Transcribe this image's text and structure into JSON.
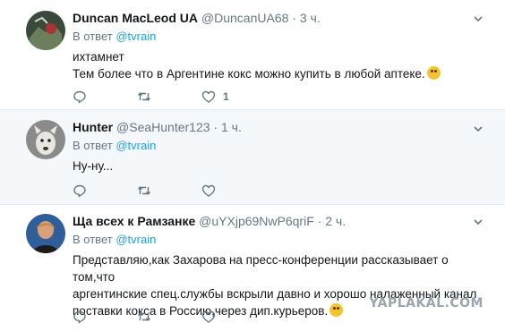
{
  "tweets": [
    {
      "name": "Duncan MacLeod UA",
      "handle": "@DuncanUA68",
      "time": "3 ч.",
      "reply_prefix": "В ответ",
      "reply_to": "@tvrain",
      "lines": [
        "ихтамнет",
        "Тем более что в Аргентине кокс можно купить в любой аптеке."
      ],
      "like_count": "1"
    },
    {
      "name": "Hunter",
      "handle": "@SeaHunter123",
      "time": "1 ч.",
      "reply_prefix": "В ответ",
      "reply_to": "@tvrain",
      "lines": [
        "Ну-ну..."
      ],
      "like_count": ""
    },
    {
      "name": "Ща всех к Рамзанке",
      "handle": "@uYXjp69NwP6qriF",
      "time": "2 ч.",
      "reply_prefix": "В ответ",
      "reply_to": "@tvrain",
      "lines": [
        "Представляю,как Захарова на пресс-конференции рассказывает о том,что",
        "аргентинские спец.службы вскрыли давно и хорошо налаженный канал",
        "поставки кокса в Россию,через дип.курьеров."
      ],
      "like_count": ""
    }
  ],
  "separator_dot": "·",
  "watermark": "YAPLAKAL.COM",
  "icons": [
    "reply-icon",
    "retweet-icon",
    "like-icon",
    "chevron-down-icon",
    "emoji-icon"
  ],
  "colors": {
    "link": "#1da1f2",
    "muted": "#657786",
    "highlight_bg": "#f5f8fa"
  }
}
